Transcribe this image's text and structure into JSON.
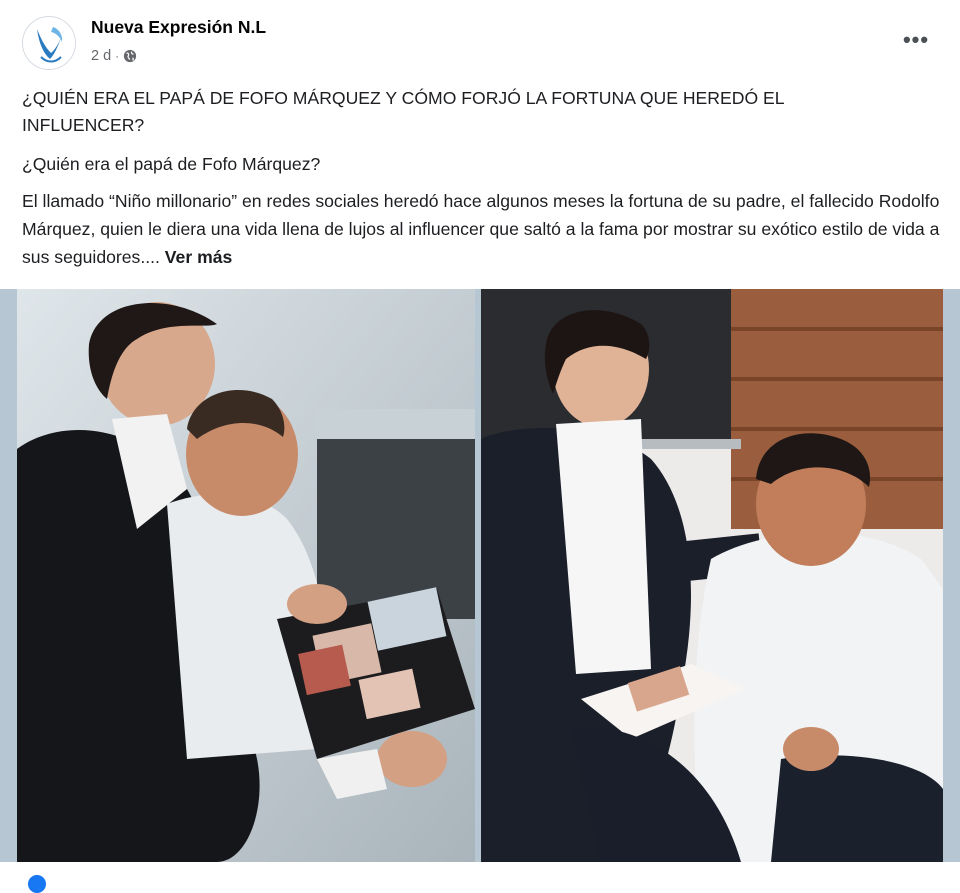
{
  "post": {
    "page_name": "Nueva Expresión N.L",
    "timestamp": "2 d",
    "separator": "·",
    "audience_icon": "globe-icon",
    "more_icon": "more-options-icon",
    "more_label": "•••",
    "headline": "¿QUIÉN ERA EL PAPÁ DE FOFO MÁRQUEZ Y CÓMO FORJÓ LA FORTUNA QUE HEREDÓ EL INFLUENCER?",
    "subheadline": "¿Quién era el papá de Fofo Márquez?",
    "body": "El llamado “Niño millonario” en redes sociales heredó hace algunos meses la fortuna de su padre, el fallecido Rodolfo Márquez, quien le diera una vida llena de lujos al influencer que saltó a la fama por mostrar su exótico estilo de vida a sus seguidores.... ",
    "see_more": "Ver más"
  },
  "colors": {
    "primary_text": "#050505",
    "secondary_text": "#65676b",
    "photo_backdrop": "#b7c6d3",
    "brand_blue": "#1877f2"
  }
}
